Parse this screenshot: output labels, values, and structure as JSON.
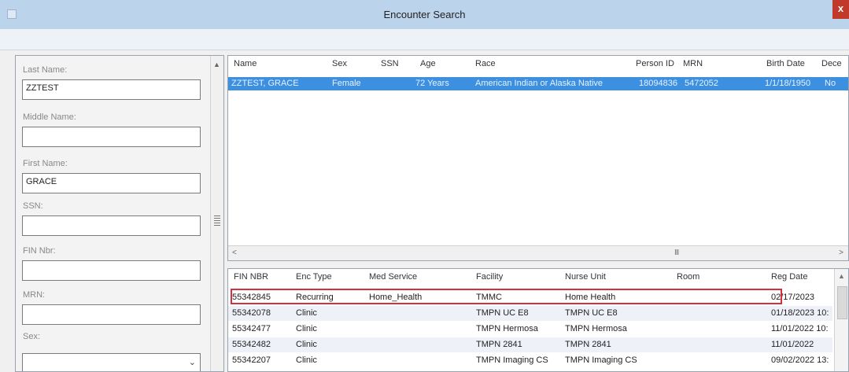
{
  "window": {
    "title": "Encounter Search",
    "close_label": "x"
  },
  "search_form": {
    "last_name_label": "Last Name:",
    "last_name_value": "ZZTEST",
    "middle_name_label": "Middle Name:",
    "middle_name_value": "",
    "first_name_label": "First Name:",
    "first_name_value": "GRACE",
    "ssn_label": "SSN:",
    "ssn_value": "",
    "fin_label": "FIN Nbr:",
    "fin_value": "",
    "mrn_label": "MRN:",
    "mrn_value": "",
    "sex_label": "Sex:",
    "sex_value": ""
  },
  "person_table": {
    "columns": [
      "Name",
      "Sex",
      "SSN",
      "Age",
      "Race",
      "Person ID",
      "MRN",
      "Birth Date",
      "Dece"
    ],
    "rows": [
      [
        "ZZTEST, GRACE",
        "Female",
        "",
        "72 Years",
        "American Indian or Alaska Native",
        "18094836",
        "5472052",
        "1/1/18/1950",
        "No"
      ]
    ]
  },
  "encounter_table": {
    "columns": [
      "FIN NBR",
      "Enc Type",
      "Med Service",
      "Facility",
      "Nurse Unit",
      "Room",
      "Reg Date"
    ],
    "rows": [
      [
        "55342845",
        "Recurring",
        "Home_Health",
        "TMMC",
        "Home Health",
        "",
        "02/17/2023"
      ],
      [
        "55342078",
        "Clinic",
        "",
        "TMPN UC E8",
        "TMPN UC E8",
        "",
        "01/18/2023 10:"
      ],
      [
        "55342477",
        "Clinic",
        "",
        "TMPN Hermosa",
        "TMPN Hermosa",
        "",
        "11/01/2022 10:"
      ],
      [
        "55342482",
        "Clinic",
        "",
        "TMPN 2841",
        "TMPN 2841",
        "",
        "11/01/2022"
      ],
      [
        "55342207",
        "Clinic",
        "",
        "TMPN Imaging CS",
        "TMPN Imaging CS",
        "",
        "09/02/2022 13:"
      ]
    ]
  },
  "scrollbar": {
    "thumb_glyph": "III"
  }
}
